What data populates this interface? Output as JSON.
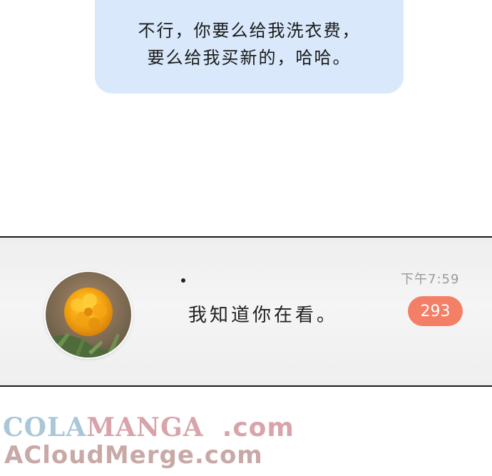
{
  "speech_bubble": {
    "line1": "不行，你要么给我洗衣费，",
    "line2": "要么给我买新的，哈哈。"
  },
  "notification": {
    "avatar": "marigold-flower-photo",
    "message": "我知道你在看。",
    "time": "下午7:59",
    "unread_count": "293"
  },
  "watermark": {
    "line1_part1": "COLA",
    "line1_part2": "MANGA",
    "line1_part3": ".com",
    "line2": "ACloudMerge.com"
  },
  "colors": {
    "bubble": "#d9e9fb",
    "badge": "#f47f67",
    "time_text": "#9a9a9a"
  }
}
